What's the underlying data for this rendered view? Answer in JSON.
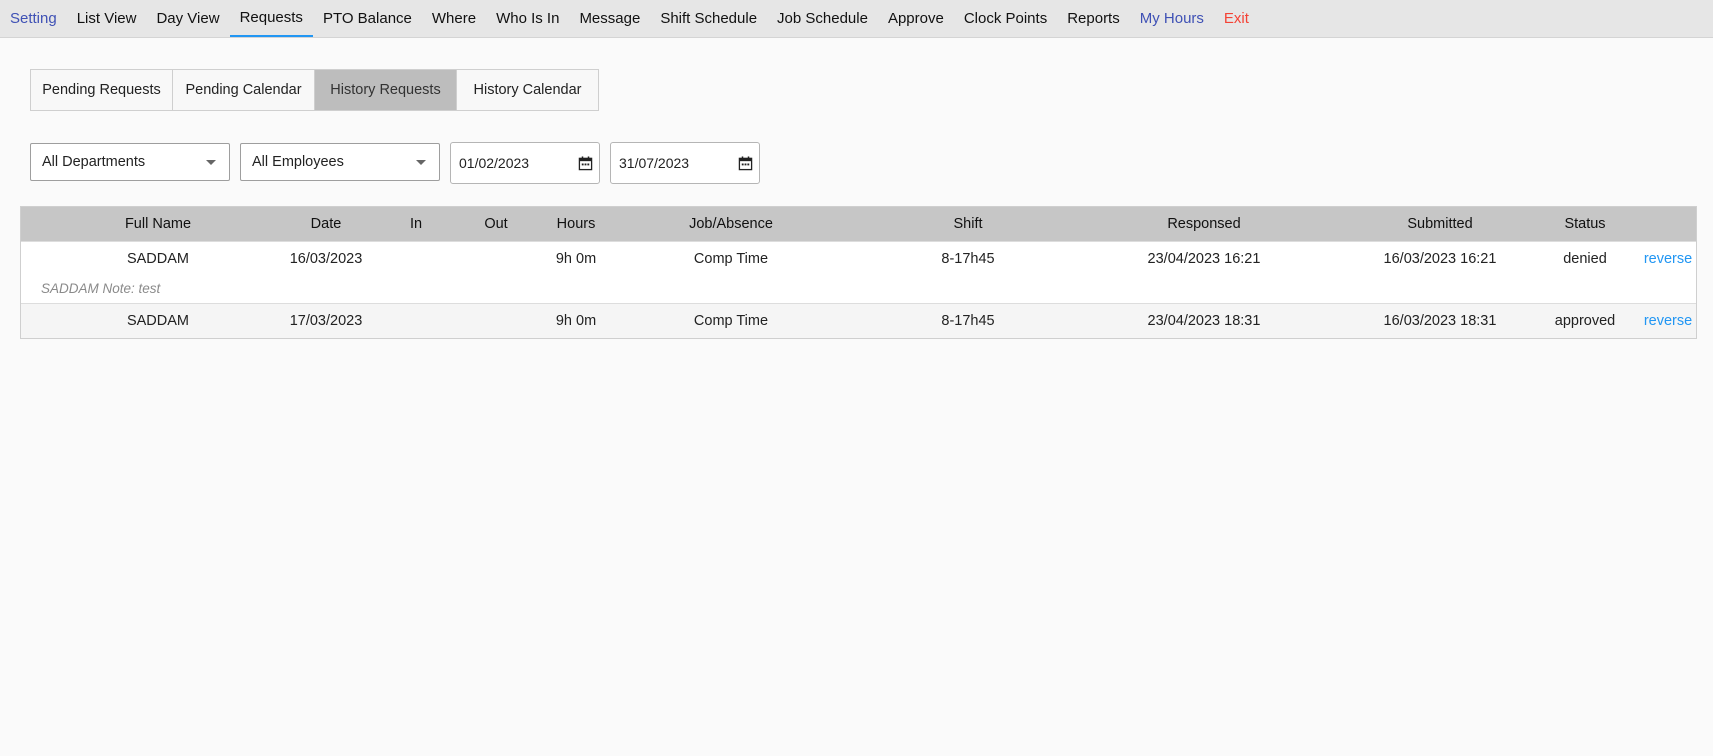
{
  "nav": {
    "items": [
      "Setting",
      "List View",
      "Day View",
      "Requests",
      "PTO Balance",
      "Where",
      "Who Is In",
      "Message",
      "Shift Schedule",
      "Job Schedule",
      "Approve",
      "Clock Points",
      "Reports",
      "My Hours",
      "Exit"
    ]
  },
  "tabs": [
    "Pending Requests",
    "Pending Calendar",
    "History Requests",
    "History Calendar"
  ],
  "filters": {
    "department": "All Departments",
    "employee": "All Employees",
    "date_from": "01/02/2023",
    "date_to": "31/07/2023"
  },
  "table": {
    "headers": [
      "Full Name",
      "Date",
      "In",
      "Out",
      "Hours",
      "Job/Absence",
      "Shift",
      "Responsed",
      "Submitted",
      "Status"
    ],
    "rows": [
      {
        "full_name": "SADDAM",
        "date": "16/03/2023",
        "in": "",
        "out": "",
        "hours": "9h 0m",
        "job": "Comp Time",
        "shift": "8-17h45",
        "responsed": "23/04/2023 16:21",
        "submitted": "16/03/2023 16:21",
        "status": "denied",
        "action": "reverse",
        "note": "SADDAM Note: test"
      },
      {
        "full_name": "SADDAM",
        "date": "17/03/2023",
        "in": "",
        "out": "",
        "hours": "9h 0m",
        "job": "Comp Time",
        "shift": "8-17h45",
        "responsed": "23/04/2023 18:31",
        "submitted": "16/03/2023 18:31",
        "status": "approved",
        "action": "reverse"
      }
    ]
  },
  "colors": {
    "accent": "#2196f3",
    "nav_blue": "#3f51b5",
    "exit_red": "#f44336",
    "header_bg": "#c6c6c6"
  }
}
